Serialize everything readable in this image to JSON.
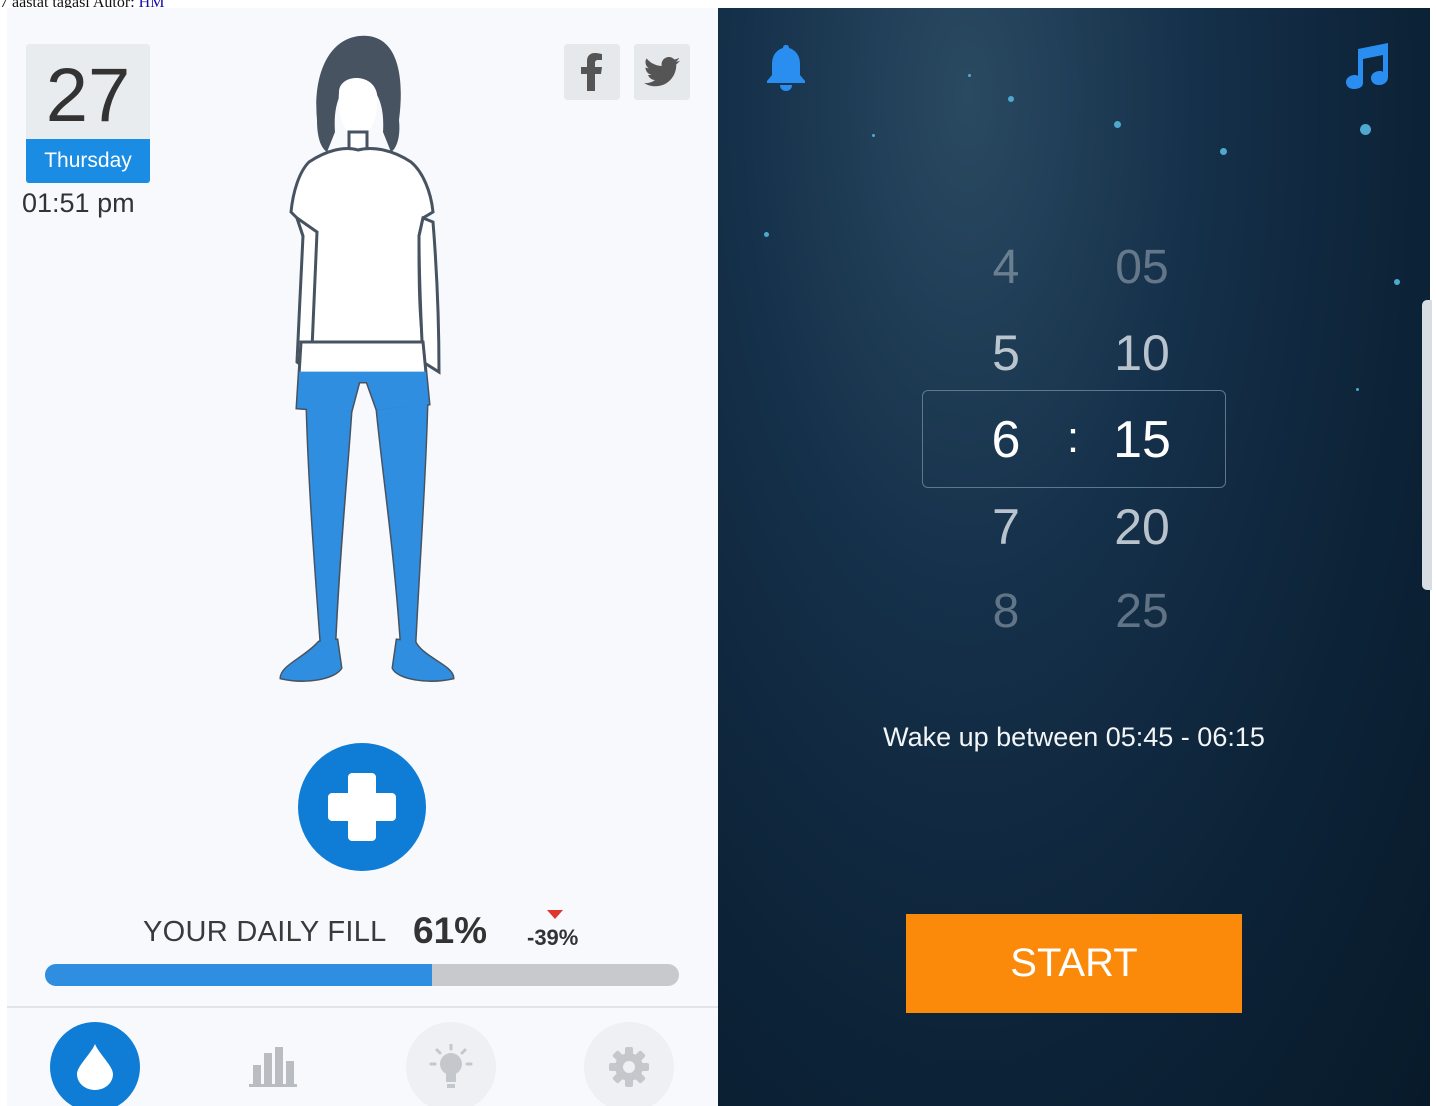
{
  "caption": {
    "text": "7 aastat tagasi Autor:",
    "link": "HM"
  },
  "water_app": {
    "date": {
      "day": "27",
      "weekday": "Thursday",
      "time": "01:51 pm"
    },
    "social": {
      "facebook_icon": "facebook-icon",
      "twitter_icon": "twitter-icon"
    },
    "figure_fill_fraction": 0.61,
    "add_icon": "plus-icon",
    "daily_fill": {
      "label": "YOUR DAILY FILL",
      "percent": "61%",
      "delta": "-39%",
      "progress": 0.61
    },
    "colors": {
      "accent": "#1a8ce3",
      "fill": "#2f8ee0",
      "track": "#c7c9cc",
      "delta_arrow": "#e0342f"
    },
    "nav": [
      {
        "icon": "water-drop-icon",
        "active": true
      },
      {
        "icon": "bar-chart-icon",
        "active": false
      },
      {
        "icon": "lightbulb-icon",
        "active": false
      },
      {
        "icon": "gear-icon",
        "active": false
      }
    ]
  },
  "alarm_app": {
    "top_icons": {
      "left": "bell-icon",
      "right": "music-note-icon"
    },
    "picker": {
      "hours": [
        "4",
        "5",
        "6",
        "7",
        "8"
      ],
      "minutes": [
        "05",
        "10",
        "15",
        "20",
        "25"
      ],
      "separator": ":",
      "selected": {
        "hour": "6",
        "minute": "15"
      }
    },
    "wake_text": "Wake up between 05:45 - 06:15",
    "start_label": "START",
    "colors": {
      "button": "#fb8a0b",
      "icons": "#2a8ef0"
    }
  }
}
